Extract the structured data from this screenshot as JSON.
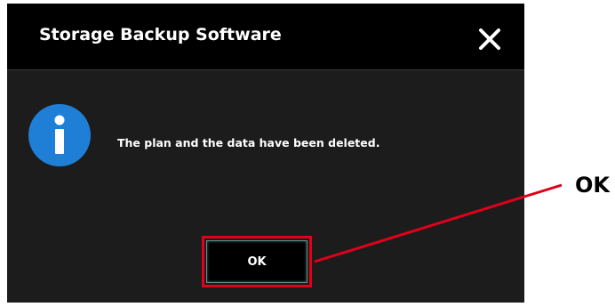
{
  "dialog": {
    "title": "Storage Backup Software",
    "message": "The plan and the data have been deleted.",
    "ok_label": "OK",
    "close_icon": "close-icon",
    "info_icon": "info-icon"
  },
  "callout": {
    "label": "OK",
    "color": "#e0001a"
  },
  "colors": {
    "dialog_bg": "#1c1c1c",
    "titlebar_bg": "#000000",
    "info_icon_blue": "#1f7fd6",
    "highlight_red": "#e0001a"
  }
}
